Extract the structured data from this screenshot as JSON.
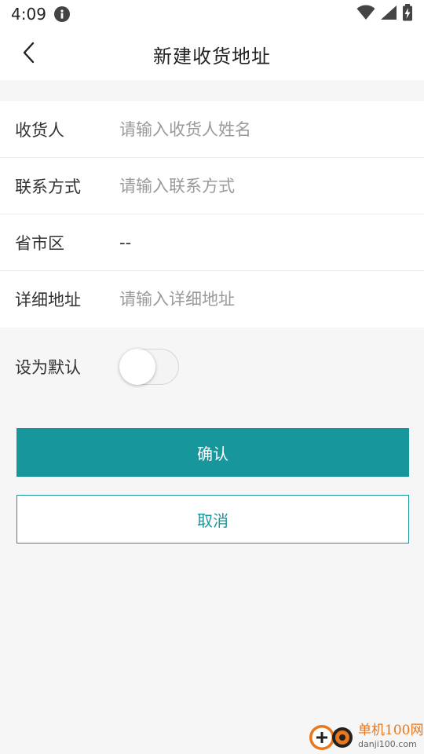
{
  "status_bar": {
    "time": "4:09",
    "icons": [
      "info-icon",
      "wifi-icon",
      "signal-icon",
      "battery-charging-icon"
    ]
  },
  "header": {
    "title": "新建收货地址",
    "back_icon": "chevron-left-icon"
  },
  "form": {
    "receiver": {
      "label": "收货人",
      "placeholder": "请输入收货人姓名",
      "value": ""
    },
    "contact": {
      "label": "联系方式",
      "placeholder": "请输入联系方式",
      "value": ""
    },
    "region": {
      "label": "省市区",
      "value": "--"
    },
    "detail": {
      "label": "详细地址",
      "placeholder": "请输入详细地址",
      "value": ""
    }
  },
  "default_setting": {
    "label": "设为默认",
    "enabled": false
  },
  "actions": {
    "confirm_label": "确认",
    "cancel_label": "取消"
  },
  "watermark": {
    "logo_icon": "danji-logo-icon",
    "cn": "单机100网",
    "en": "danji100.com"
  },
  "colors": {
    "accent": "#17969b",
    "background": "#f6f6f6",
    "watermark": "#e8771d"
  }
}
